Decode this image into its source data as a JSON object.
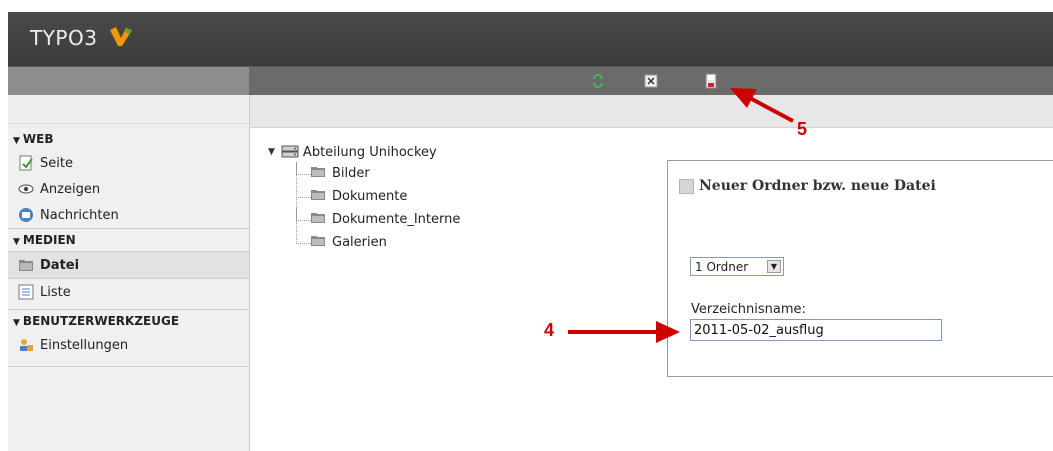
{
  "app": {
    "logo_text": "TYPO3"
  },
  "toolbar": {
    "reload_icon": "reload-icon",
    "close_icon": "close-icon",
    "save_icon": "save-icon"
  },
  "sidebar": {
    "sections": [
      {
        "label": "WEB",
        "items": [
          {
            "label": "Seite",
            "icon": "page-icon"
          },
          {
            "label": "Anzeigen",
            "icon": "eye-icon"
          },
          {
            "label": "Nachrichten",
            "icon": "news-icon"
          }
        ]
      },
      {
        "label": "MEDIEN",
        "items": [
          {
            "label": "Datei",
            "icon": "folder-icon",
            "active": true
          },
          {
            "label": "Liste",
            "icon": "list-icon"
          }
        ]
      },
      {
        "label": "BENUTZERWERKZEUGE",
        "items": [
          {
            "label": "Einstellungen",
            "icon": "user-settings-icon"
          }
        ]
      }
    ]
  },
  "tree": {
    "root": "Abteilung Unihockey",
    "children": [
      "Bilder",
      "Dokumente",
      "Dokumente_Interne",
      "Galerien"
    ]
  },
  "panel": {
    "title": "Neuer Ordner bzw. neue Datei",
    "count_select": "1 Ordner",
    "field_label": "Verzeichnisname:",
    "field_value": "2011-05-02_ausflug"
  },
  "annotations": {
    "arrow_4": "4",
    "arrow_5": "5"
  },
  "colors": {
    "annotation": "#cc0000",
    "header_bg": "#3b3b3b",
    "toolbar_bg": "#6b6b6b",
    "logo_orange": "#f49700"
  }
}
